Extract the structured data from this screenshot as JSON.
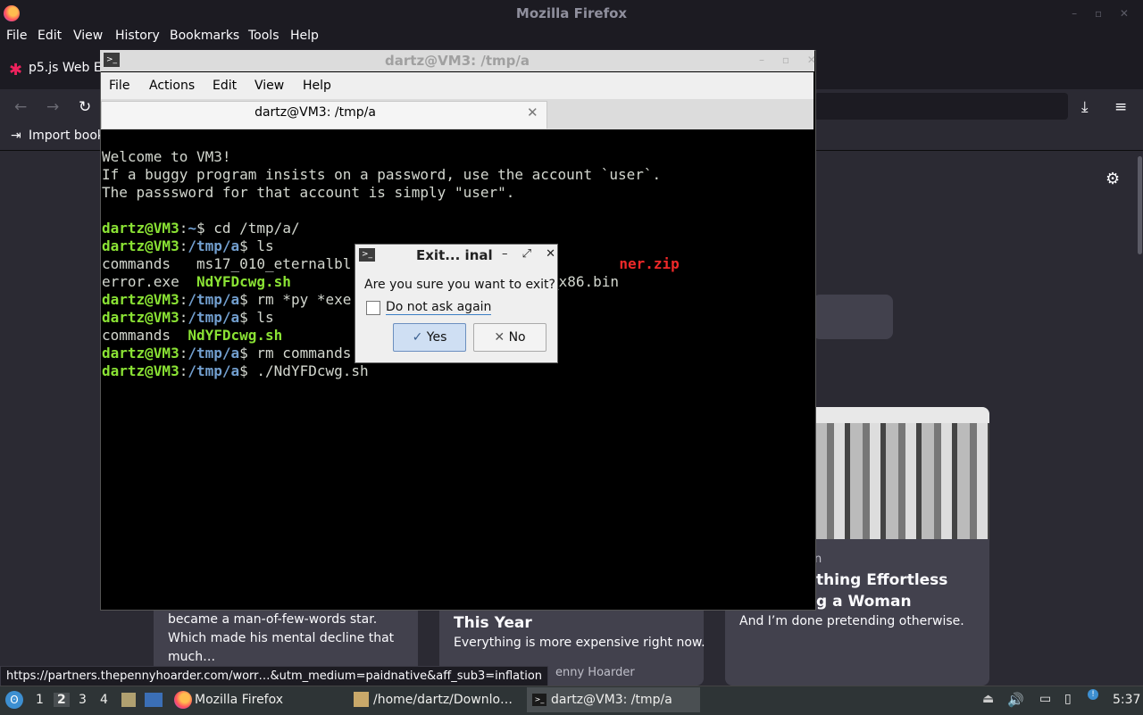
{
  "firefox": {
    "window_title": "Mozilla Firefox",
    "menu": [
      "File",
      "Edit",
      "View",
      "History",
      "Bookmarks",
      "Tools",
      "Help"
    ],
    "tab_label": "p5.js Web E",
    "bookmark_label": "Import book",
    "status_url": "https://partners.thepennyhoarder.com/worr…&utm_medium=paidnative&aff_sub3=inflation",
    "stories": [
      {
        "text": "became a man-of-few-words star. Which made his mental decline that much…"
      },
      {
        "title": "This Year",
        "text": "Everything is more expensive right now.",
        "source": "enny Hoarder"
      },
      {
        "kicker": "n",
        "title_1": "thing Effortless",
        "title_2": "g a Woman",
        "text": "And I’m done pretending otherwise."
      }
    ]
  },
  "terminal": {
    "window_title": "dartz@VM3: /tmp/a",
    "menu": [
      "File",
      "Actions",
      "Edit",
      "View",
      "Help"
    ],
    "tab_label": "dartz@VM3: /tmp/a",
    "lines": {
      "l1": "Welcome to VM3!",
      "l2": "If a buggy program insists on a password, use the account `user`.",
      "l3": "The passsword for that account is simply \"user\".",
      "prompt_user": "dartz@VM3",
      "home": "~",
      "tmp": "/tmp/a",
      "cmd1": "$ cd /tmp/a/",
      "cmd2": "$ ls",
      "ls1_a": "commands   ms17_010_eternalbl",
      "ls1_b": "ner.zip",
      "ls2_a": "error.exe  ",
      "ls2_b": "NdYFDcwg.sh",
      "ls2_c": "_x86.bin",
      "cmd3": "$ rm *py *exe",
      "cmd4": "$ ls",
      "ls3_a": "commands  ",
      "ls3_b": "NdYFDcwg.sh",
      "cmd5": "$ rm commands",
      "cmd6": "$ ./NdYFDcwg.sh"
    }
  },
  "dialog": {
    "title": "Exit... inal",
    "question": "Are you sure you want to exit?",
    "checkbox_label": "Do not ask again",
    "yes": "Yes",
    "no": "No"
  },
  "taskbar": {
    "workspaces": [
      "1",
      "2",
      "3",
      "4"
    ],
    "tasks": [
      "Mozilla Firefox",
      "/home/dartz/Downlo…",
      "dartz@VM3: /tmp/a"
    ],
    "clock": "5:37"
  }
}
